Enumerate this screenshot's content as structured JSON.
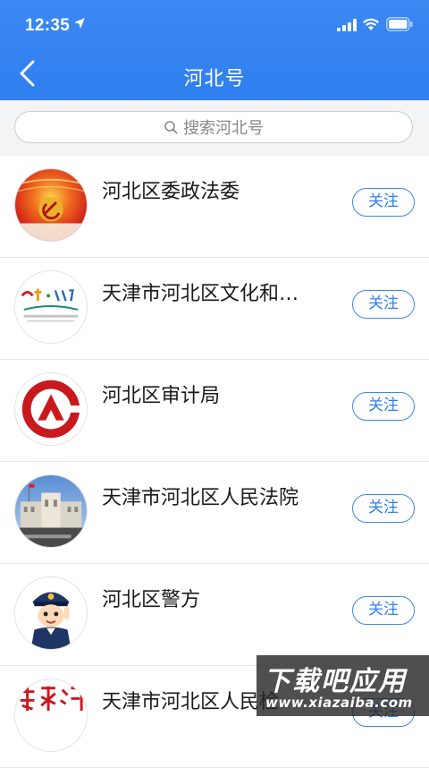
{
  "status_bar": {
    "time": "12:35",
    "icons": [
      "location-arrow-icon",
      "signal-icon",
      "wifi-icon",
      "battery-icon"
    ]
  },
  "header": {
    "title": "河北号",
    "back_icon": "chevron-left-icon",
    "color": "#3384f2"
  },
  "search": {
    "placeholder": "搜索河北号",
    "icon": "search-icon"
  },
  "list": {
    "items": [
      {
        "name": "河北区委政法委",
        "button": "关注",
        "avatar": "party-emblem"
      },
      {
        "name": "天津市河北区文化和…",
        "button": "关注",
        "avatar": "culture-logo"
      },
      {
        "name": "河北区审计局",
        "button": "关注",
        "avatar": "audit-emblem"
      },
      {
        "name": "天津市河北区人民法院",
        "button": "关注",
        "avatar": "court-photo"
      },
      {
        "name": "河北区警方",
        "button": "关注",
        "avatar": "police-cartoon"
      },
      {
        "name": "天津市河北区人民检",
        "button": "关注",
        "avatar": "procuratorate-logo"
      }
    ]
  },
  "watermark": {
    "title": "下载吧应用",
    "url": "www.xiazaiba.com"
  },
  "colors": {
    "accent": "#2f7ff0",
    "divider": "#e7e7e7",
    "search_bg": "#f3f4f6"
  }
}
